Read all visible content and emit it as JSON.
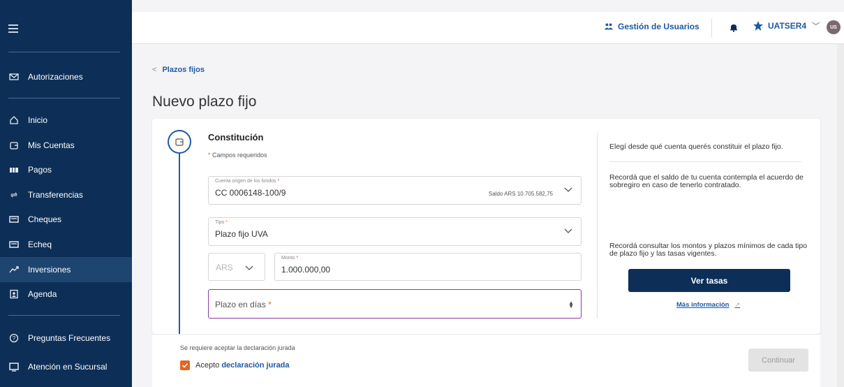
{
  "sidebar": {
    "items_top": [
      {
        "label": "Autorizaciones",
        "icon": "envelope-icon"
      }
    ],
    "items_main": [
      {
        "label": "Inicio",
        "icon": "home-icon"
      },
      {
        "label": "Mis Cuentas",
        "icon": "wallet-icon"
      },
      {
        "label": "Pagos",
        "icon": "payments-icon"
      },
      {
        "label": "Transferencias",
        "icon": "transfer-arrows-icon"
      },
      {
        "label": "Cheques",
        "icon": "cheque-icon"
      },
      {
        "label": "Echeq",
        "icon": "echeq-icon"
      },
      {
        "label": "Inversiones",
        "icon": "chart-up-icon"
      },
      {
        "label": "Agenda",
        "icon": "contacts-icon"
      }
    ],
    "items_bottom": [
      {
        "label": "Preguntas Frecuentes",
        "icon": "question-icon"
      },
      {
        "label": "Atención en Sucursal",
        "icon": "branch-screen-icon"
      }
    ],
    "active_item": "Inversiones"
  },
  "topbar": {
    "gestion_label": "Gestión de Usuarios",
    "user_name": "UATSER4",
    "avatar_initials": "US"
  },
  "breadcrumb": {
    "back_label": "Plazos fijos"
  },
  "page": {
    "title": "Nuevo plazo fijo"
  },
  "form": {
    "section_title": "Constitución",
    "required_note": "Campos requeridos",
    "cuenta": {
      "label": "Cuenta origen de los fondos",
      "value": "CC 0006148-100/9",
      "saldo": "Saldo ARS 10.705.582,75"
    },
    "tipo": {
      "label": "Tipo",
      "value": "Plazo fijo UVA"
    },
    "moneda": {
      "value": "ARS"
    },
    "monto": {
      "label": "Monto",
      "value": "1.000.000,00"
    },
    "plazo": {
      "placeholder": "Plazo en días"
    }
  },
  "info": {
    "text1": "Elegí desde qué cuenta querés constituir el plazo fijo.",
    "text2": "Recordá que el saldo de tu cuenta contempla el acuerdo de sobregiro en caso de tenerlo contratado.",
    "text3": "Recordá consultar los montos y plazos mínimos de cada tipo de plazo fijo y las tasas vigentes.",
    "ver_tasas": "Ver tasas",
    "mas_info": "Más información"
  },
  "footer": {
    "declaration_note": "Se requiere aceptar la declaración jurada",
    "accept_prefix": "Acepto",
    "accept_link": "declaración jurada",
    "continue": "Continuar"
  },
  "colors": {
    "sidebar": "#0d2f57",
    "accent": "#1c5aa6",
    "checkbox": "#e5651e",
    "focus": "#8b3aa3"
  }
}
